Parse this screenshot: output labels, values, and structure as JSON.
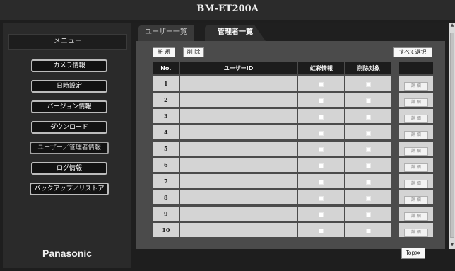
{
  "window": {
    "title": "BM-ET200A"
  },
  "sidebar": {
    "header": "メニュー",
    "items": [
      {
        "label": "カメラ情報",
        "name": "menu-camera-info",
        "dim": false
      },
      {
        "label": "日時設定",
        "name": "menu-datetime",
        "dim": false
      },
      {
        "label": "バージョン情報",
        "name": "menu-version",
        "dim": false
      },
      {
        "label": "ダウンロード",
        "name": "menu-download",
        "dim": false
      },
      {
        "label": "ユーザー／管理者情報",
        "name": "menu-user-admin",
        "dim": true
      },
      {
        "label": "ログ情報",
        "name": "menu-log",
        "dim": false
      },
      {
        "label": "バックアップ／リストア",
        "name": "menu-backup",
        "dim": false
      }
    ],
    "logo": "Panasonic"
  },
  "tabs": [
    {
      "label": "ユーザー一覧",
      "active": false
    },
    {
      "label": "管理者一覧",
      "active": true
    }
  ],
  "toolbar": {
    "new_label": "新 規",
    "delete_label": "削 除",
    "select_all_label": "すべて選択"
  },
  "table": {
    "headers": [
      "No.",
      "ユーザーID",
      "虹彩情報",
      "削除対象",
      ""
    ],
    "rows": [
      {
        "no": "1",
        "user_id": "",
        "detail": "詳 細"
      },
      {
        "no": "2",
        "user_id": "",
        "detail": "詳 細"
      },
      {
        "no": "3",
        "user_id": "",
        "detail": "詳 細"
      },
      {
        "no": "4",
        "user_id": "",
        "detail": "詳 細"
      },
      {
        "no": "5",
        "user_id": "",
        "detail": "詳 細"
      },
      {
        "no": "6",
        "user_id": "",
        "detail": "詳 細"
      },
      {
        "no": "7",
        "user_id": "",
        "detail": "詳 細"
      },
      {
        "no": "8",
        "user_id": "",
        "detail": "詳 細"
      },
      {
        "no": "9",
        "user_id": "",
        "detail": "詳 細"
      },
      {
        "no": "10",
        "user_id": "",
        "detail": "詳 細"
      }
    ]
  },
  "footer": {
    "top_label": "Top≫"
  },
  "icons": {
    "scroll_up": "triangle-up-icon",
    "scroll_down": "triangle-down-icon"
  }
}
